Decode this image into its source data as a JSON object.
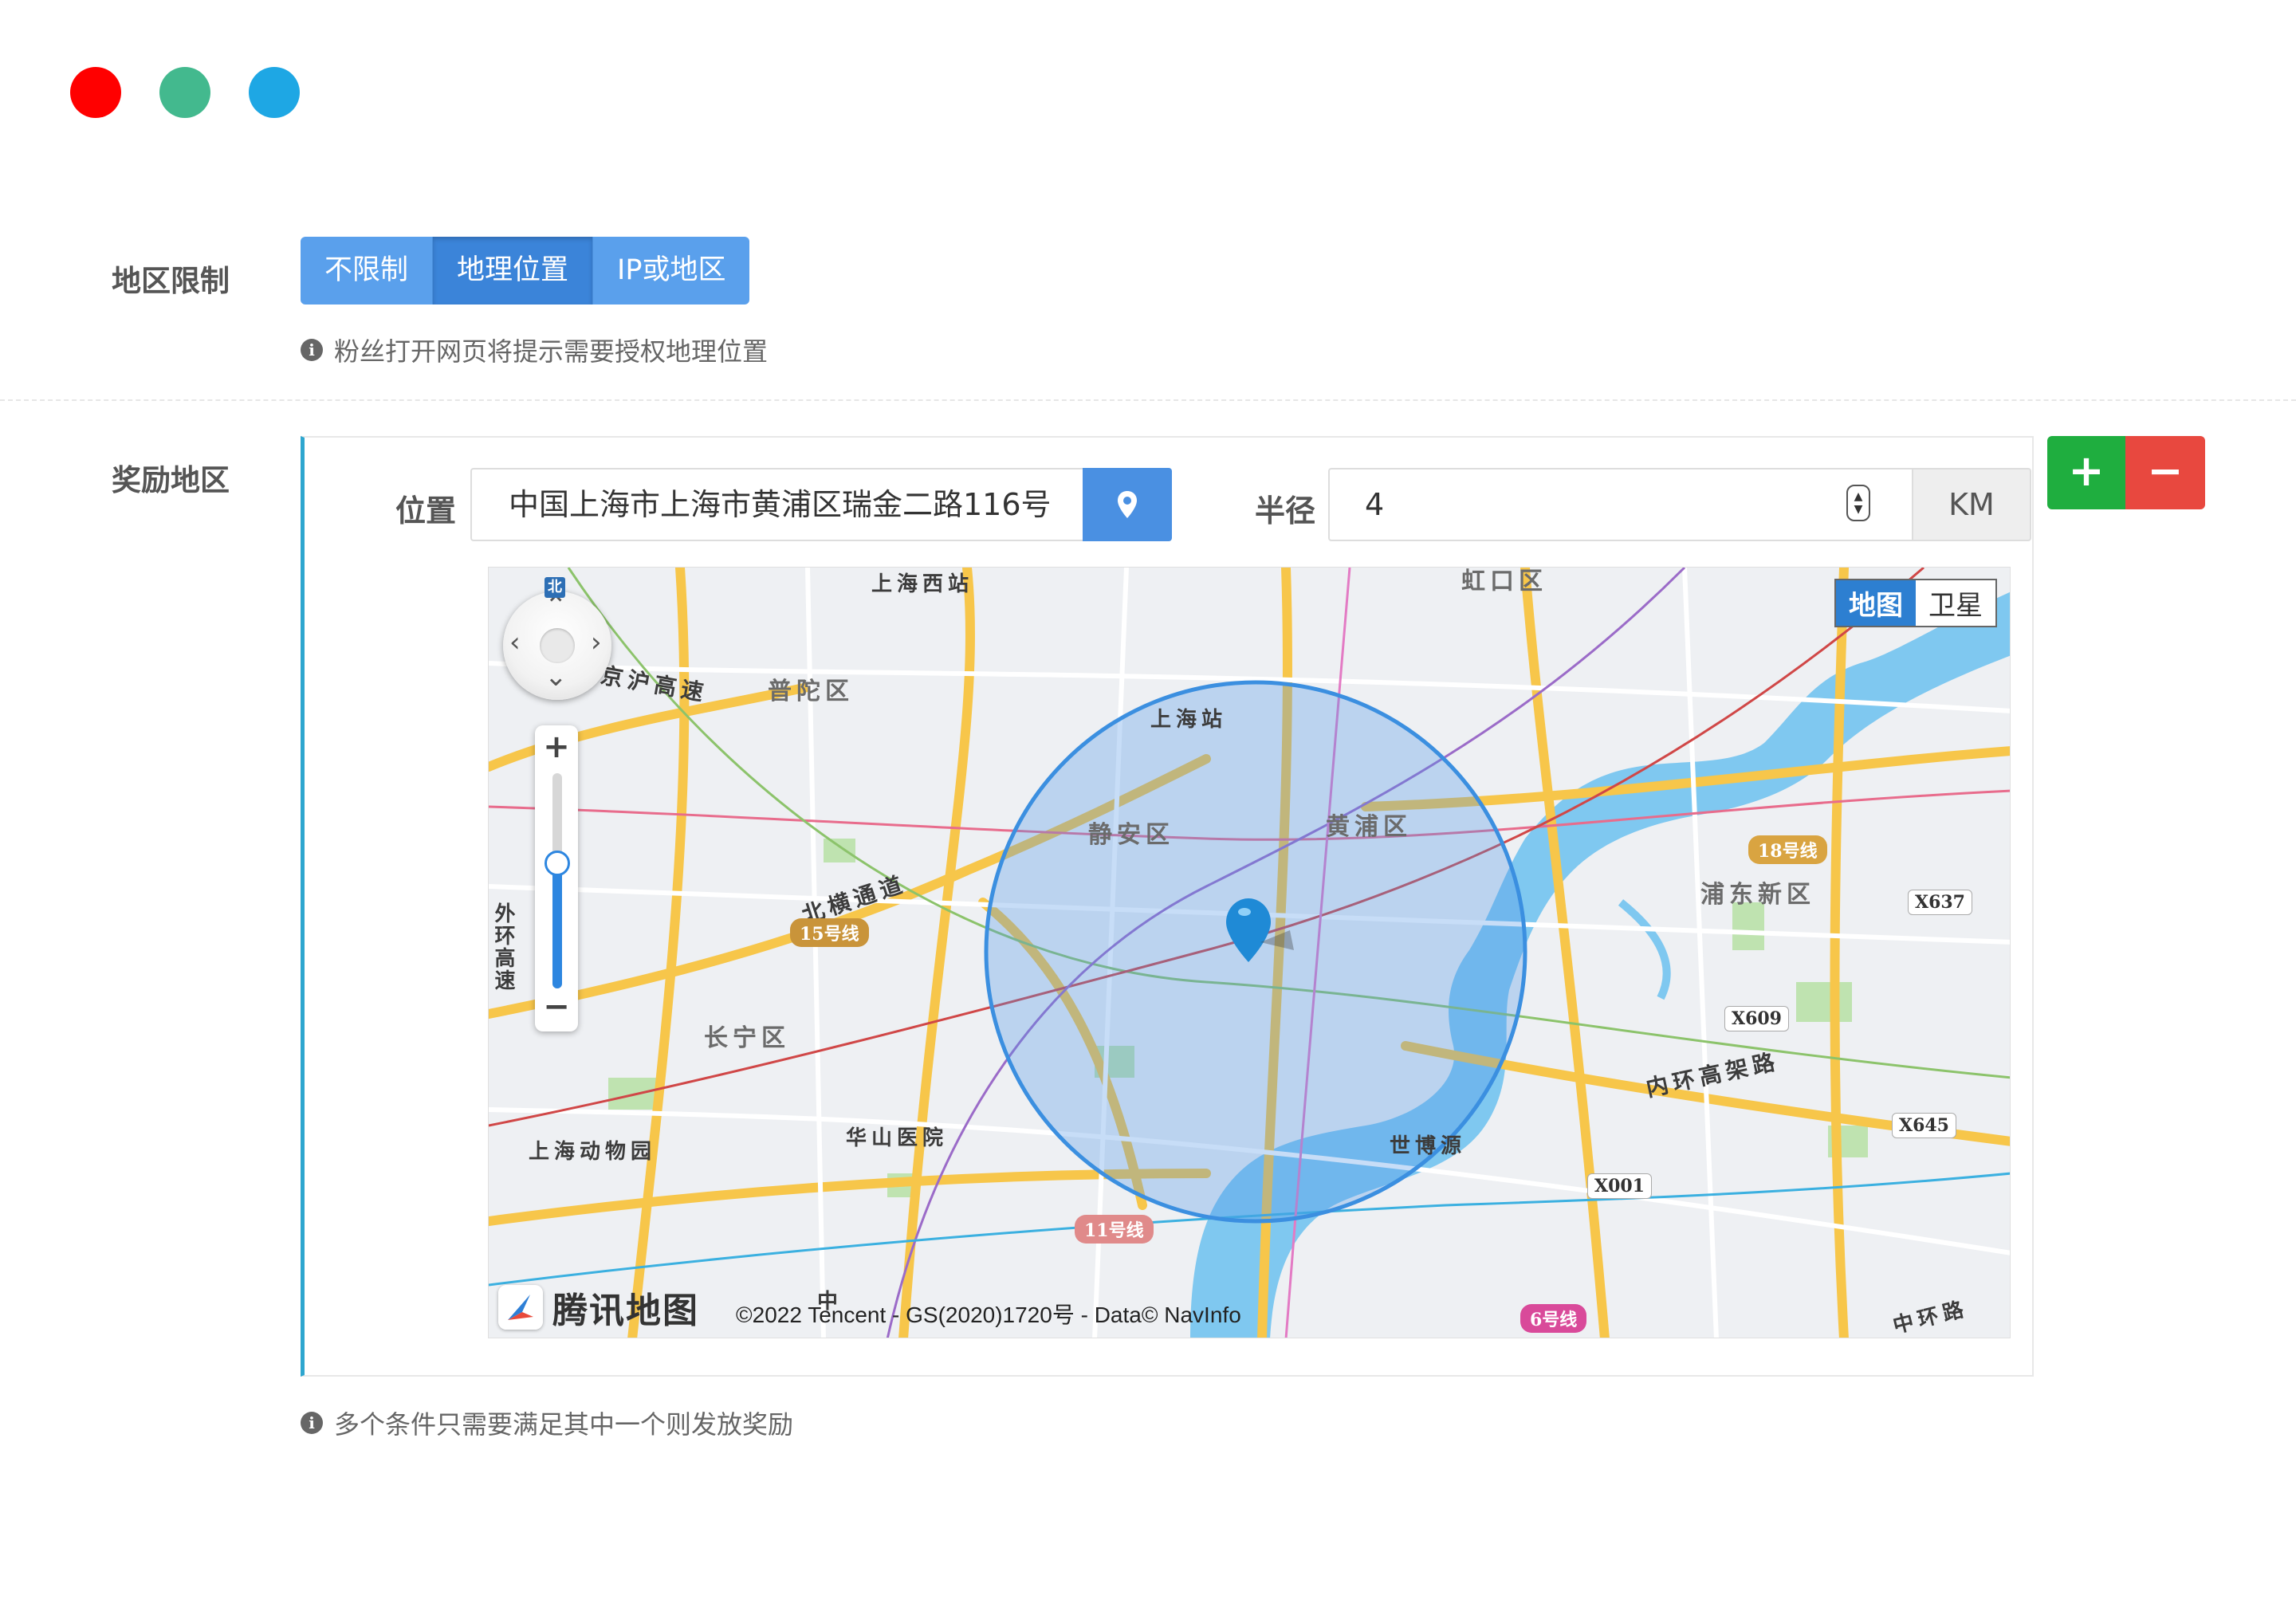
{
  "window_dots": {
    "colors": [
      "#ff0000",
      "#43b98e",
      "#1ea7e4"
    ]
  },
  "region_limit": {
    "label": "地区限制",
    "options": [
      "不限制",
      "地理位置",
      "IP或地区"
    ],
    "selected": "地理位置",
    "hint": "粉丝打开网页将提示需要授权地理位置"
  },
  "reward_region": {
    "label": "奖励地区",
    "location_label": "位置",
    "location_value": "中国上海市上海市黄浦区瑞金二路116号",
    "location_icon": "map-pin-icon",
    "radius_label": "半径",
    "radius_value": "4",
    "radius_unit": "KM",
    "add_symbol": "+",
    "remove_symbol": "−",
    "hint": "多个条件只需要满足其中一个则发放奖励"
  },
  "map": {
    "type_options": [
      "地图",
      "卫星"
    ],
    "type_selected": "地图",
    "north": "北",
    "zoom_in": "+",
    "zoom_out": "−",
    "zoom_level_fraction": 0.58,
    "logo_text": "腾讯地图",
    "copyright": "©2022 Tencent - GS(2020)1720号 - Data© NavInfo",
    "district_labels": [
      "静安区",
      "黄浦区",
      "普陀区",
      "长宁区",
      "浦东新区",
      "虹口区"
    ],
    "place_labels": [
      "上海西站",
      "上海站",
      "上海动物园",
      "华山医院",
      "世博源"
    ],
    "road_labels": [
      "京沪高速",
      "北横通道",
      "内环高架路",
      "中环路",
      "外环高速",
      "中"
    ],
    "road_codes": [
      "X637",
      "X609",
      "X645",
      "X001"
    ],
    "metro_badges": [
      {
        "text": "18号线",
        "color": "#d9a441"
      },
      {
        "text": "15号线",
        "color": "#c9943a"
      },
      {
        "text": "11号线",
        "color": "#e08a8a"
      },
      {
        "text": "6号线",
        "color": "#d94a9a"
      }
    ],
    "circle_color": "#3b8fe0"
  }
}
